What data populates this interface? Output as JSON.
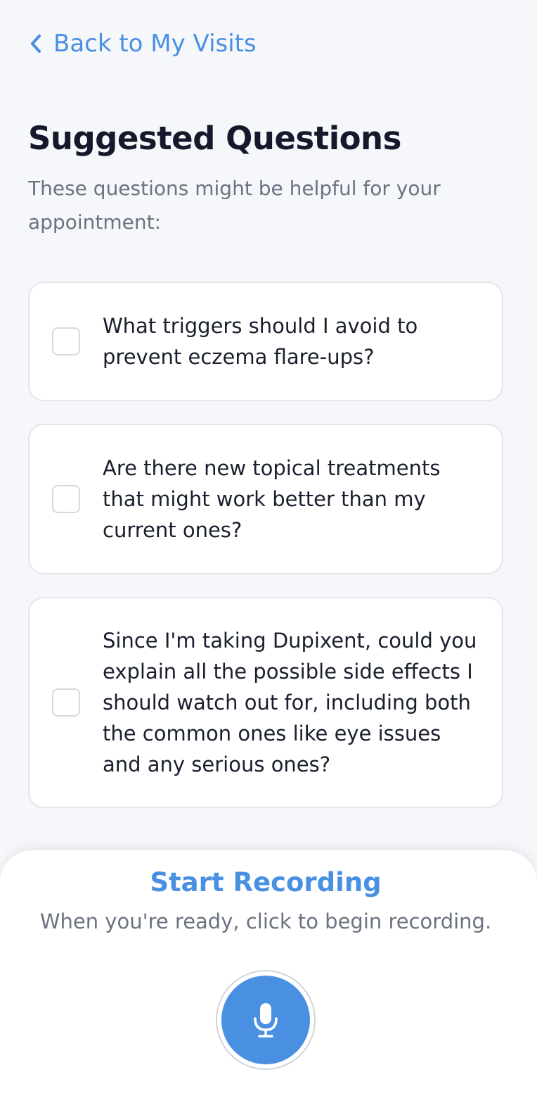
{
  "nav": {
    "back_label": "Back to My Visits"
  },
  "header": {
    "title": "Suggested Questions",
    "subtitle": "These questions might be helpful for your appointment:"
  },
  "questions": [
    {
      "text": "What triggers should I avoid to prevent eczema flare-ups?",
      "checked": false
    },
    {
      "text": "Are there new topical treatments that might work better than my current ones?",
      "checked": false
    },
    {
      "text": "Since I'm taking Dupixent, could you explain all the possible side effects I should watch out for, including both the common ones like eye issues and any serious ones?",
      "checked": false
    }
  ],
  "recording": {
    "title": "Start Recording",
    "subtitle": "When you're ready, click to begin recording.",
    "icon": "microphone-icon"
  },
  "colors": {
    "accent": "#4a90e2",
    "background": "#f5f7fa",
    "text_primary": "#141a2b",
    "text_secondary": "#6b7280",
    "card_border": "#e3e6eb"
  }
}
